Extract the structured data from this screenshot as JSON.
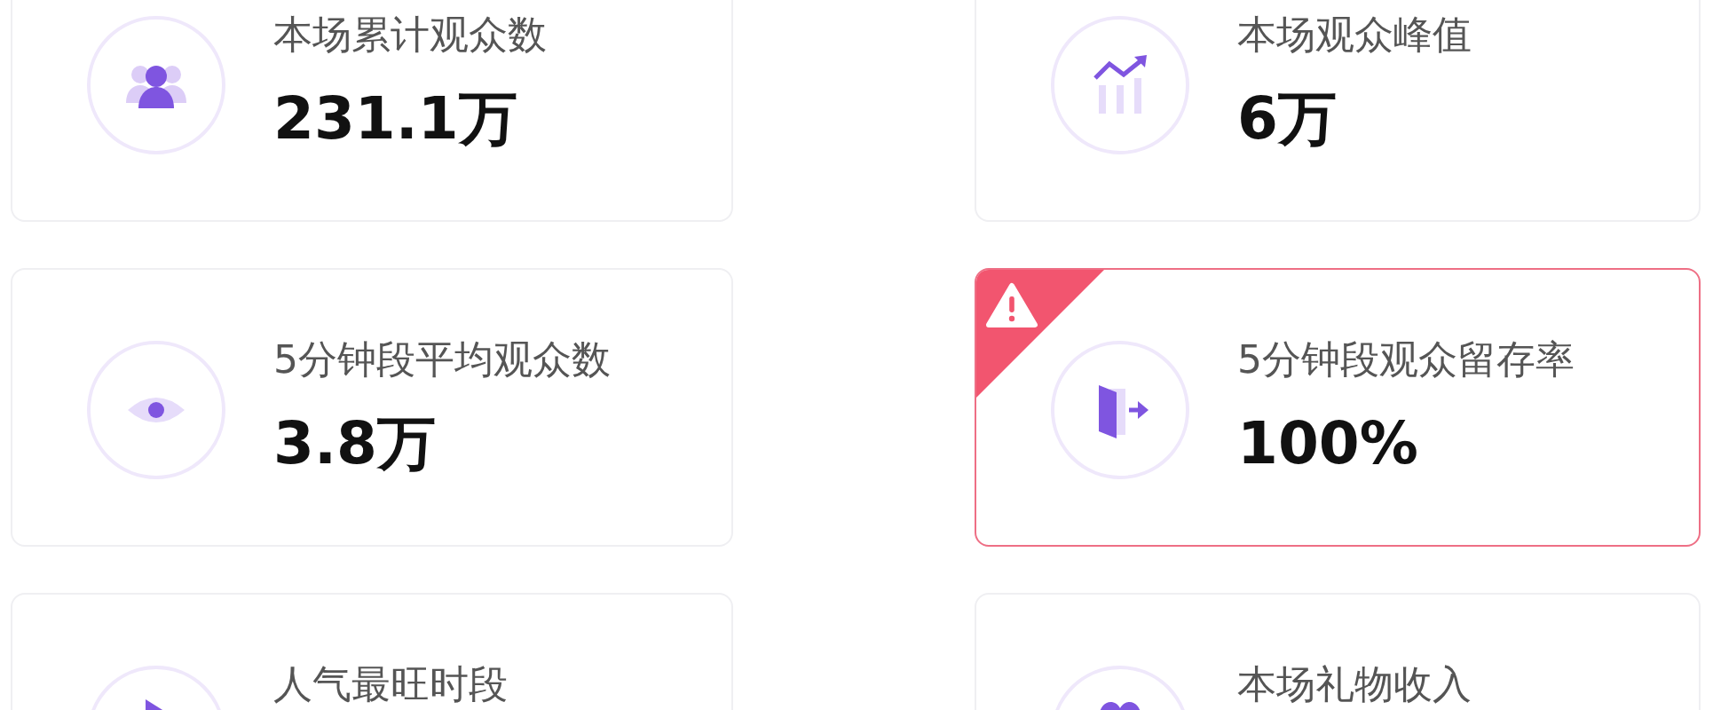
{
  "cards": [
    {
      "kind": "people",
      "label": "本场累计观众数",
      "value": "231.1万",
      "alert": false
    },
    {
      "kind": "chart",
      "label": "本场观众峰值",
      "value": "6万",
      "alert": false
    },
    {
      "kind": "eye",
      "label": "5分钟段平均观众数",
      "value": "3.8万",
      "alert": false
    },
    {
      "kind": "door",
      "label": "5分钟段观众留存率",
      "value": "100%",
      "alert": true
    },
    {
      "kind": "play",
      "label": "人气最旺时段",
      "alert": false
    },
    {
      "kind": "heart",
      "label": "本场礼物收入",
      "alert": false
    }
  ]
}
